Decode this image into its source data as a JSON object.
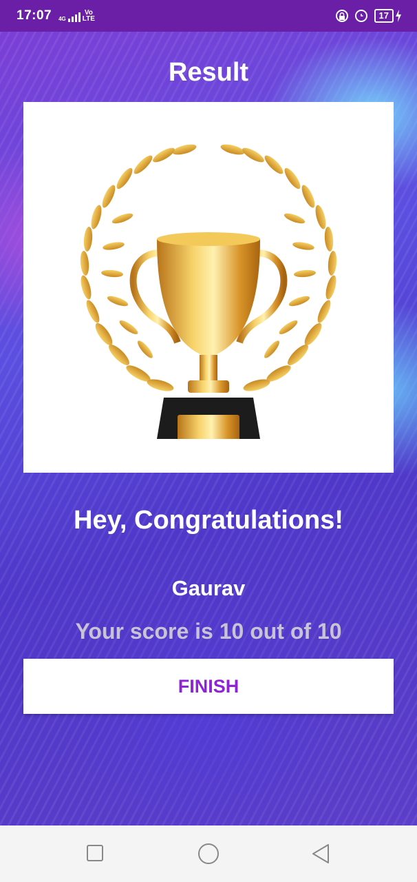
{
  "status_bar": {
    "time": "17:07",
    "network_type": "4G",
    "volte": "Vo\nLTE",
    "battery": "17",
    "icons": [
      "signal-icon",
      "lock-icon",
      "alarm-icon",
      "battery-icon",
      "charging-icon"
    ]
  },
  "screen": {
    "title": "Result",
    "trophy_image": "trophy-with-laurel-wreath",
    "congrats_text": "Hey, Congratulations!",
    "user_name": "Gaurav",
    "score_text": "Your score is 10 out of 10",
    "finish_label": "FINISH"
  },
  "colors": {
    "status_bar": "#6a1fa6",
    "finish_text": "#8e24d8",
    "score_text": "#c9c3d6"
  },
  "nav_bar": {
    "icons": [
      "recent-apps-icon",
      "home-icon",
      "back-icon"
    ]
  }
}
